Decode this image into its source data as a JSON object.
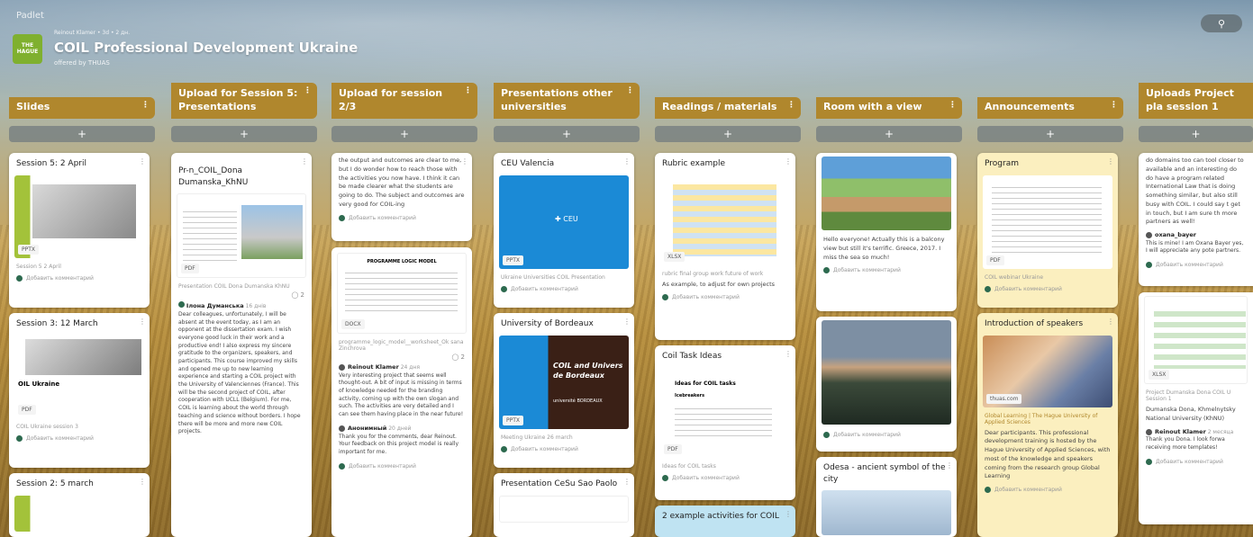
{
  "app": {
    "brand": "Padlet",
    "meta": "Reinout Klamer • 3d • 2 дн.",
    "title": "COIL Professional Development Ukraine",
    "subtitle": "offered by THUAS",
    "logo_text": "THE HAGUE",
    "search_icon": "search-icon"
  },
  "columns": [
    {
      "title": "Slides"
    },
    {
      "title": "Upload for Session 5: Presentations"
    },
    {
      "title": "Upload for session 2/3"
    },
    {
      "title": "Presentations other universities"
    },
    {
      "title": "Readings / materials"
    },
    {
      "title": "Room with a view"
    },
    {
      "title": "Announcements"
    },
    {
      "title": "Uploads Project pla session 1"
    }
  ],
  "add_label": "+",
  "comment_label": "Добавить комментарий",
  "slides": [
    {
      "title": "Session 5: 2 April",
      "tag": "PPTX",
      "caption": "Session 5 2 April"
    },
    {
      "title": "Session 3: 12 March",
      "tag": "PDF",
      "caption": "COIL Ukraine session 3",
      "slide_text": "OIL Ukraine"
    },
    {
      "title": "Session 2: 5 march"
    }
  ],
  "upload5": {
    "card_title": "Pr-n_COIL_Dona Dumanska_KhNU",
    "tag": "PDF",
    "caption": "Presentation COIL Dona Dumanska KhNU",
    "count": "2",
    "comment_author": "Ілона Думанська",
    "comment_time": "16 днів",
    "comment_text": "Dear colleagues, unfortunately, I will be absent at the event today, as I am an opponent at the dissertation exam. I wish everyone good luck in their work and a productive end! I also express my sincere gratitude to the organizers, speakers, and participants. This course improved my skills and opened me up to new learning experience and starting a COIL project with the University of Valenciennes (France). This will be the second project of COIL, after cooperation with UCLL (Belgium). For me, COIL is learning about the world through teaching and science without borders. I hope there will be more and more new COIL projects."
  },
  "upload23": {
    "top_text": "the output and outcomes are clear to me, but I do wonder how to reach those with the activities you now have. I think it can be made clearer what the students are going to do. The subject and outcomes are very good for COIL-ing",
    "doc_heading": "PROGRAMME LOGIC MODEL",
    "tag": "DOCX",
    "caption": "programme_logic_model__worksheet_Ok sana Zinchrova",
    "count": "2",
    "c1_author": "Reinout Klamer",
    "c1_time": "24 дня",
    "c1_text": "Very interesting project that seems well thought-out. A bit of input is missing in terms of knowledge needed for the branding activity, coming up with the own slogan and such. The activities are very detailed and I can see them having place in the near future!",
    "c2_author": "Анонимный",
    "c2_time": "20 дней",
    "c2_text": "Thank you for the comments, dear Reinout. Your feedback on this project model is really important for me."
  },
  "others": [
    {
      "title": "CEU Valencia",
      "tag": "PPTX",
      "caption": "Ukraine Universities COIL Presentation",
      "logo": "CEU"
    },
    {
      "title": "University of Bordeaux",
      "tag": "PPTX",
      "caption": "Meeting Ukraine 26 march",
      "slide_text": "COIL and Univers de Bordeaux",
      "sub_text": "université BORDEAUX"
    },
    {
      "title": "Presentation CeSu Sao Paolo"
    }
  ],
  "readings": [
    {
      "title": "Rubric example",
      "tag": "XLSX",
      "caption": "rubric final group work future of work",
      "body": "As example, to adjust for own projects"
    },
    {
      "title": "Coil Task Ideas",
      "tag": "PDF",
      "caption": "Ideas for COIL tasks",
      "doc_title": "Ideas for COIL tasks",
      "doc_sub": "Icebreakers"
    },
    {
      "title": "2 example activities for COIL"
    }
  ],
  "room": [
    {
      "body": "Hello everyone! Actually this is a balcony view but still it's terrific. Greece, 2017. I miss the sea so much!"
    },
    {},
    {
      "title": "Odesa - ancient symbol of the city"
    }
  ],
  "announcements": [
    {
      "title": "Program",
      "tag": "PDF",
      "caption": "COIL webinar Ukraine"
    },
    {
      "title": "Introduction of speakers",
      "link_tag": "thuas.com",
      "link_title": "Global Learning | The Hague University of Applied Sciences",
      "body": "Dear participants. This professional development training is hosted by the Hague University of Applied Sciences, with most of the knowledge and speakers coming from the research group Global Learning"
    }
  ],
  "project": [
    {
      "body": "do domains too can tool closer to available and an interesting do do have a program related International Law that is doing something similar, but also still busy with COIL. I could say t get in touch, but I am sure th more partners as well!",
      "author": "oxana_bayer",
      "reply": "This is mine! I am Oxana Bayer yes, I will appreciate any pote partners."
    },
    {
      "tag": "XLSX",
      "caption": "Project Dumanska Dona COIL U Session 1",
      "body": "Dumanska Dona, Khmelnytsky National University (KhNU)",
      "author": "Reinout Klamer",
      "time": "2 месяца",
      "reply": "Thank you Dona. I look forwa receiving more templates!"
    }
  ],
  "colors": {
    "header": "#b0872d",
    "card": "#ffffff",
    "yellow_card": "#fbefbf",
    "blue_card": "#bfe3f2"
  }
}
